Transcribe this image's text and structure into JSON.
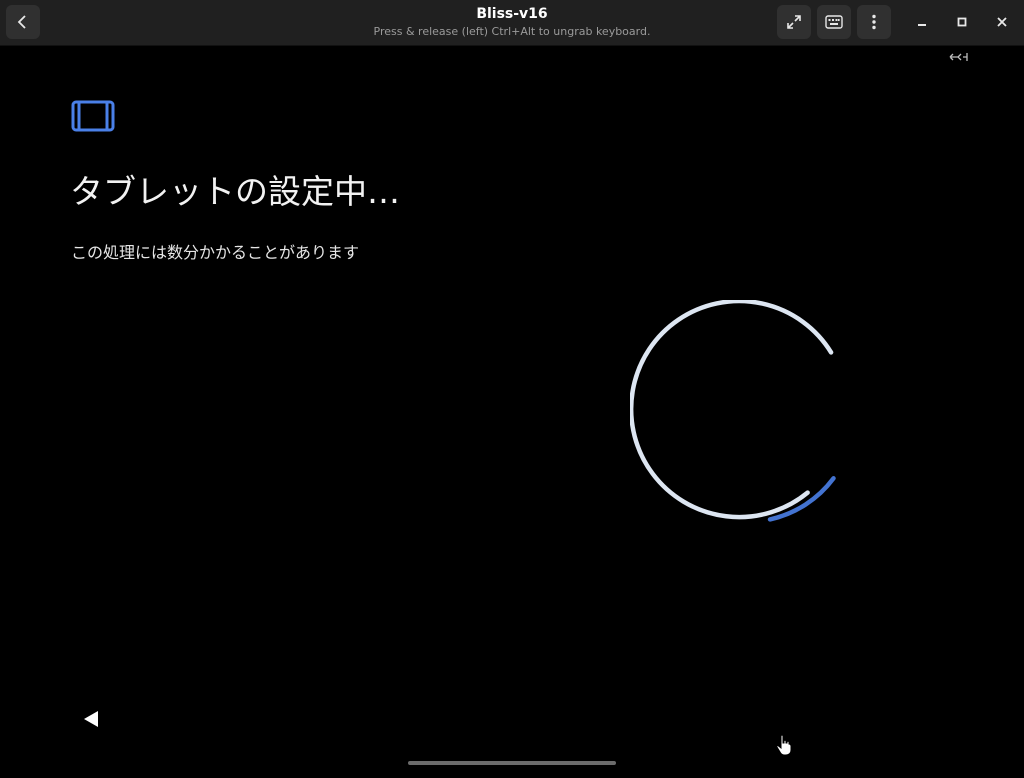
{
  "window": {
    "title": "Bliss-v16",
    "subtitle": "Press & release (left) Ctrl+Alt to ungrab keyboard."
  },
  "toolbar": {
    "back_icon": "chevron-left-icon",
    "fullscreen_icon": "fullscreen-icon",
    "keyboard_icon": "keyboard-icon",
    "menu_icon": "vertical-dots-icon",
    "minimize_icon": "minimize-icon",
    "maximize_icon": "maximize-icon",
    "close_icon": "close-icon"
  },
  "setup": {
    "heading": "タブレットの設定中…",
    "description": "この処理には数分かかることがあります",
    "icon": "tablet-icon",
    "accent_color": "#4a80e8",
    "spinner_color": "#dde6f2"
  },
  "navigation": {
    "back_icon": "triangle-back-icon",
    "home_indicator": "home-bar"
  }
}
